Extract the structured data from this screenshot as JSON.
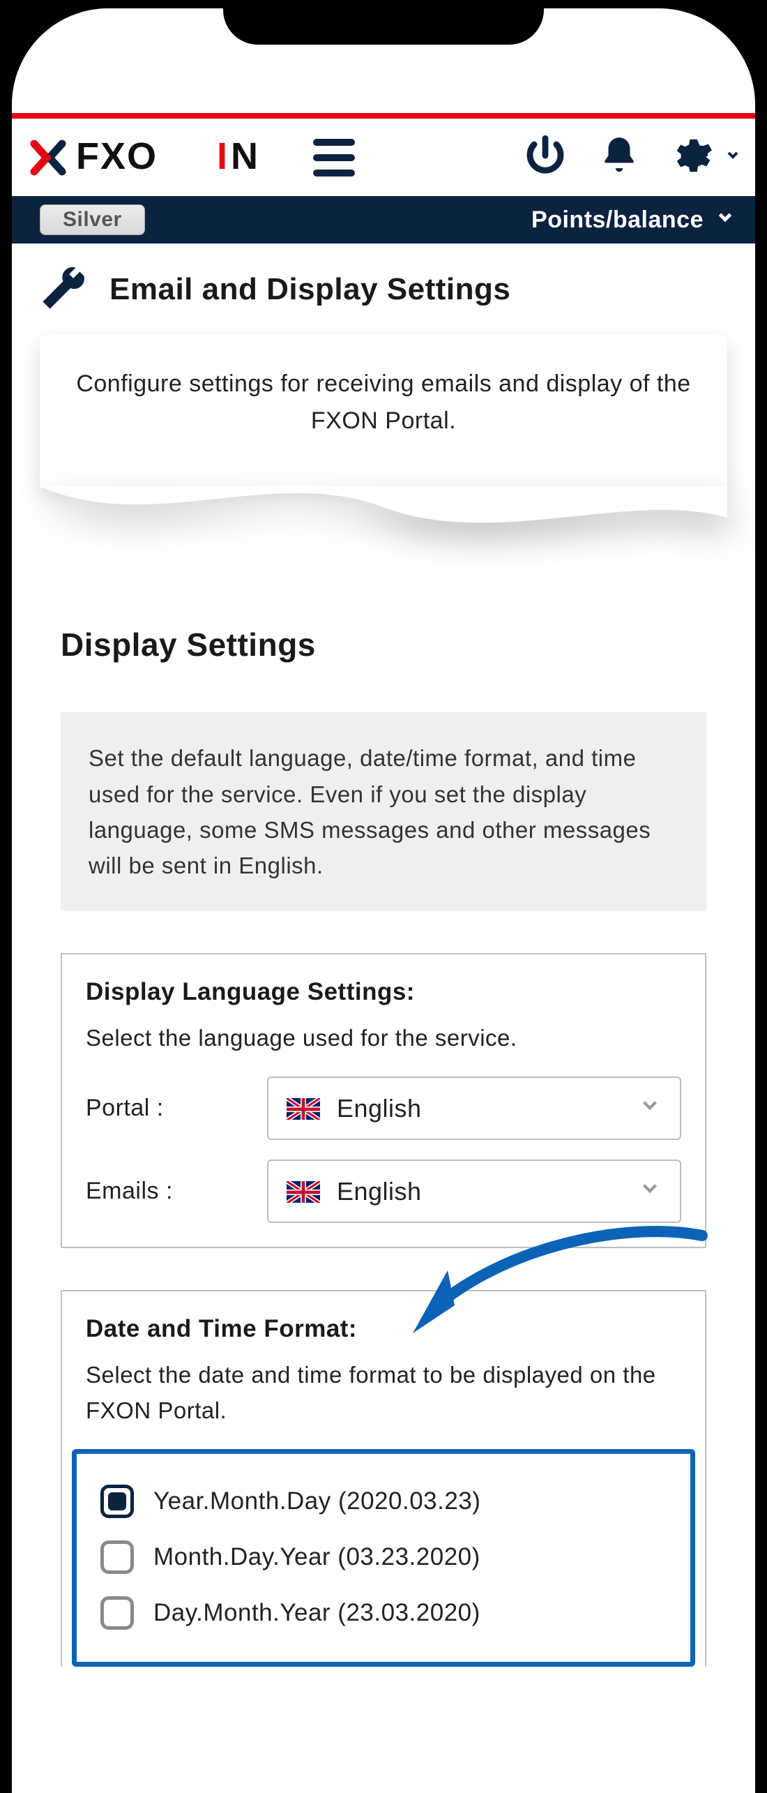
{
  "header": {
    "brand_text": "FXON",
    "tier_badge": "Silver",
    "points_label": "Points/balance"
  },
  "page": {
    "title": "Email and Display Settings",
    "intro": "Configure settings for receiving emails and display of the FXON Portal."
  },
  "section": {
    "heading": "Display Settings",
    "note": "Set the default language, date/time format, and time used for the service. Even if you set the display language, some SMS messages and other messages will be sent in English."
  },
  "language_panel": {
    "title": "Display Language Settings:",
    "desc": "Select the language used for the service.",
    "portal_label": "Portal :",
    "emails_label": "Emails :",
    "portal_value": "English",
    "emails_value": "English"
  },
  "date_panel": {
    "title": "Date and Time Format:",
    "desc": "Select the date and time format to be displayed on the FXON Portal.",
    "options": [
      {
        "label": "Year.Month.Day (2020.03.23)",
        "selected": true
      },
      {
        "label": "Month.Day.Year (03.23.2020)",
        "selected": false
      },
      {
        "label": "Day.Month.Year (23.03.2020)",
        "selected": false
      }
    ]
  }
}
